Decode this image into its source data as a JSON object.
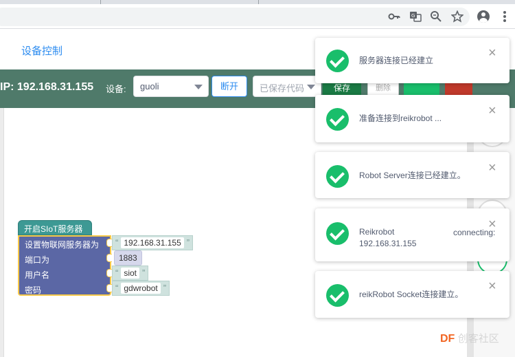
{
  "browser": {
    "icons": [
      "key-icon",
      "translate-icon",
      "zoom-icon",
      "star-icon",
      "account-icon",
      "menu-icon"
    ]
  },
  "page": {
    "title": "设备控制"
  },
  "controls": {
    "ip": "IP: 192.168.31.155",
    "device_label": "设备:",
    "device_value": "guoli",
    "disconnect": "断开",
    "saved_code_placeholder": "已保存代码",
    "save": "保存",
    "delete": "删除"
  },
  "blocks": {
    "hat": "开启SIoT服务器",
    "rows": [
      {
        "label": "设置物联网服务器为",
        "value": "192.168.31.155",
        "kind": "text"
      },
      {
        "label": "端口为",
        "value": "1883",
        "kind": "number"
      },
      {
        "label": "用户名",
        "value": "siot",
        "kind": "text"
      },
      {
        "label": "密码",
        "value": "gdwrobot",
        "kind": "text"
      }
    ],
    "quote_open": "“",
    "quote_close": "”"
  },
  "notifications": [
    {
      "text": "服务器连接已经建立",
      "close": "×"
    },
    {
      "text": "准备连接到reikrobot ...",
      "close": "×"
    },
    {
      "text": "Robot Server连接已经建立。",
      "close": "×"
    },
    {
      "text": "Reikrobot",
      "sub": "192.168.31.155",
      "right": "connecting:",
      "close": "×"
    },
    {
      "text": "reikRobot Socket连接建立。",
      "close": "×"
    }
  ],
  "watermark": {
    "brand": "DF",
    "rest": "创客社区"
  },
  "colors": {
    "accent": "#2d8cf0",
    "success": "#19be6b",
    "bar": "#4f7a6a",
    "block": "#5b67a5"
  }
}
